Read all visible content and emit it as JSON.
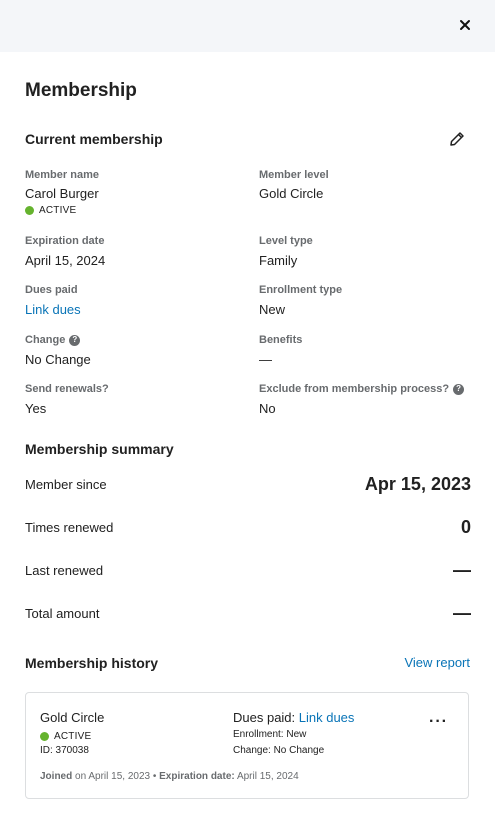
{
  "header": {
    "close_icon": "close-icon"
  },
  "page_title": "Membership",
  "current": {
    "heading": "Current membership",
    "edit_icon": "pencil-icon",
    "member_name_label": "Member name",
    "member_name": "Carol Burger",
    "status": "ACTIVE",
    "member_level_label": "Member level",
    "member_level": "Gold Circle",
    "expiration_label": "Expiration date",
    "expiration": "April 15, 2024",
    "level_type_label": "Level type",
    "level_type": "Family",
    "dues_label": "Dues paid",
    "dues_link": "Link dues",
    "enrollment_label": "Enrollment type",
    "enrollment": "New",
    "change_label": "Change",
    "change": "No Change",
    "benefits_label": "Benefits",
    "benefits": "—",
    "renewals_label": "Send renewals?",
    "renewals": "Yes",
    "exclude_label": "Exclude from membership process?",
    "exclude": "No",
    "help_glyph": "?"
  },
  "summary": {
    "heading": "Membership summary",
    "rows": [
      {
        "label": "Member since",
        "value": "Apr 15, 2023"
      },
      {
        "label": "Times renewed",
        "value": "0"
      },
      {
        "label": "Last renewed",
        "value": "—"
      },
      {
        "label": "Total amount",
        "value": "—"
      }
    ]
  },
  "history": {
    "heading": "Membership history",
    "view_report": "View report",
    "card": {
      "level": "Gold Circle",
      "status": "ACTIVE",
      "id": "ID: 370038",
      "dues_label": "Dues paid: ",
      "dues_link": "Link dues",
      "enrollment": "Enrollment: New",
      "change": "Change: No Change",
      "more": "···",
      "joined_label": "Joined",
      "joined_text": " on April 15, 2023 • ",
      "exp_label": "Expiration date:",
      "exp_text": " April 15, 2024"
    }
  },
  "colors": {
    "active_dot": "#65b32e",
    "link": "#0974b7",
    "header_bg": "#f4f6f9"
  }
}
